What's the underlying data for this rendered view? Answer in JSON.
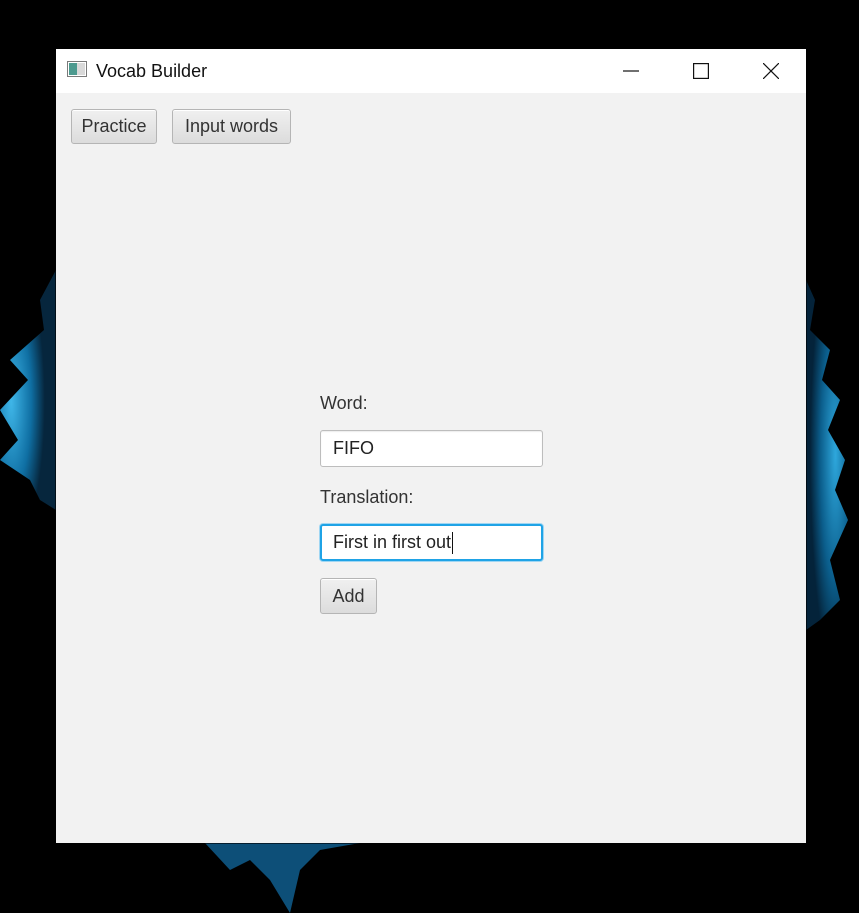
{
  "window": {
    "title": "Vocab Builder",
    "controls": {
      "minimize": "minimize-icon",
      "maximize": "maximize-icon",
      "close": "close-icon"
    }
  },
  "toolbar": {
    "practice_label": "Practice",
    "input_words_label": "Input words"
  },
  "form": {
    "word_label": "Word:",
    "word_value": "FIFO",
    "translation_label": "Translation:",
    "translation_value": "First in first out",
    "add_label": "Add"
  },
  "colors": {
    "focus_border": "#1fa3e6",
    "window_background": "#f2f2f2",
    "titlebar_background": "#ffffff",
    "desktop_background": "#000000"
  }
}
